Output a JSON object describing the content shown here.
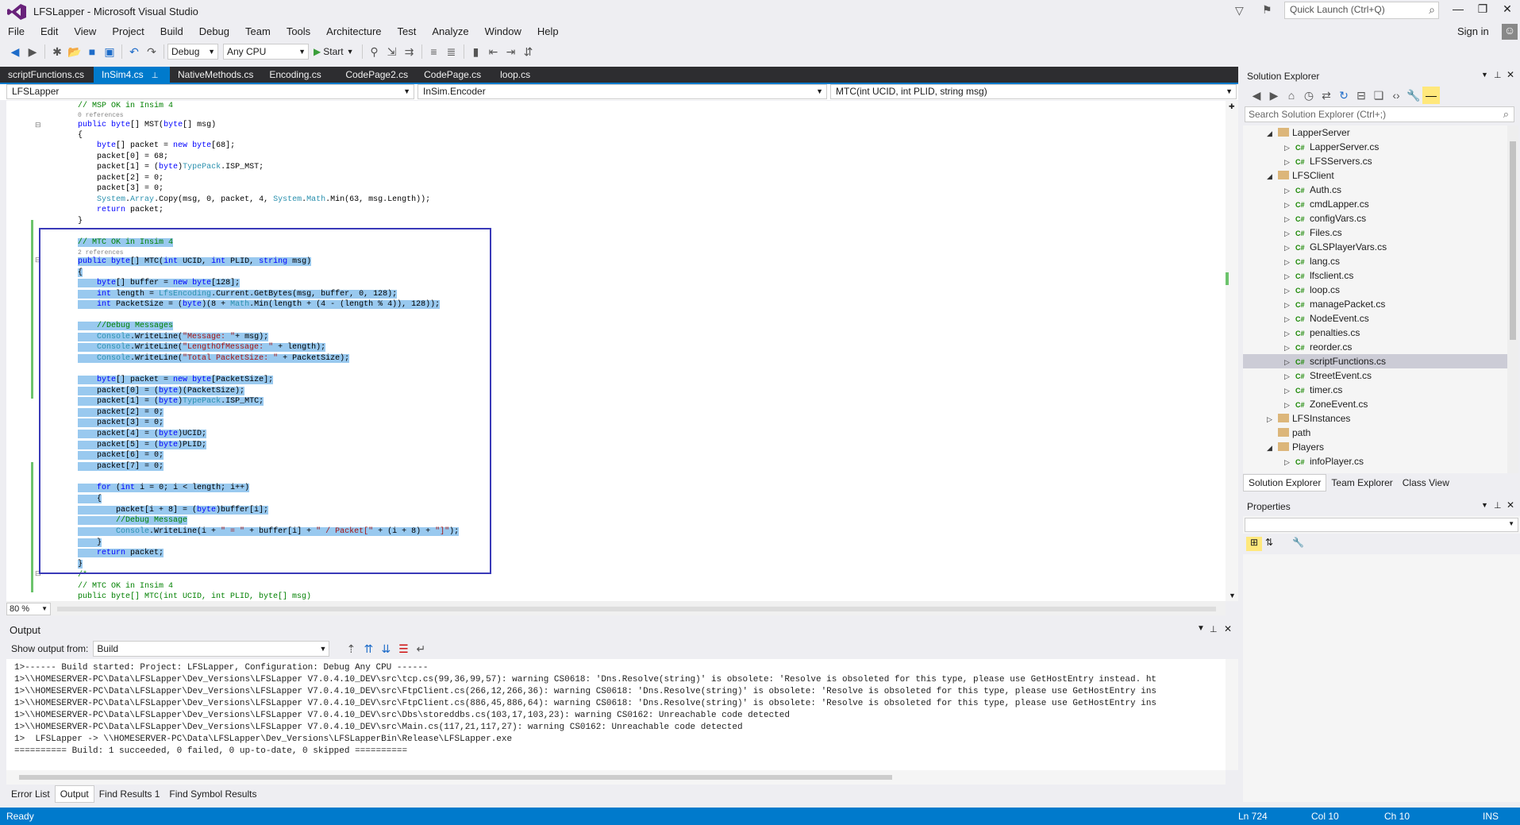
{
  "window": {
    "title": "LFSLapper - Microsoft Visual Studio",
    "quick_launch_placeholder": "Quick Launch (Ctrl+Q)",
    "sign_in": "Sign in"
  },
  "menu": [
    "File",
    "Edit",
    "View",
    "Project",
    "Build",
    "Debug",
    "Team",
    "Tools",
    "Architecture",
    "Test",
    "Analyze",
    "Window",
    "Help"
  ],
  "toolbar": {
    "config": "Debug",
    "platform": "Any CPU",
    "start_label": "Start"
  },
  "tabs": [
    {
      "label": "scriptFunctions.cs",
      "active": false
    },
    {
      "label": "InSim4.cs",
      "active": true
    },
    {
      "label": "NativeMethods.cs",
      "active": false
    },
    {
      "label": "Encoding.cs",
      "active": false
    },
    {
      "label": "CodePage2.cs",
      "active": false
    },
    {
      "label": "CodePage.cs",
      "active": false
    },
    {
      "label": "loop.cs",
      "active": false
    }
  ],
  "navbar": {
    "project": "LFSLapper",
    "type": "InSim.Encoder",
    "member": "MTC(int UCID, int PLID, string msg)"
  },
  "editor": {
    "zoom": "80 %"
  },
  "output": {
    "title": "Output",
    "show_from_label": "Show output from:",
    "source": "Build",
    "lines": [
      "1>------ Build started: Project: LFSLapper, Configuration: Debug Any CPU ------",
      "1>\\\\HOMESERVER-PC\\Data\\LFSLapper\\Dev_Versions\\LFSLapper V7.0.4.10_DEV\\src\\tcp.cs(99,36,99,57): warning CS0618: 'Dns.Resolve(string)' is obsolete: 'Resolve is obsoleted for this type, please use GetHostEntry instead. ht",
      "1>\\\\HOMESERVER-PC\\Data\\LFSLapper\\Dev_Versions\\LFSLapper V7.0.4.10_DEV\\src\\FtpClient.cs(266,12,266,36): warning CS0618: 'Dns.Resolve(string)' is obsolete: 'Resolve is obsoleted for this type, please use GetHostEntry ins",
      "1>\\\\HOMESERVER-PC\\Data\\LFSLapper\\Dev_Versions\\LFSLapper V7.0.4.10_DEV\\src\\FtpClient.cs(886,45,886,64): warning CS0618: 'Dns.Resolve(string)' is obsolete: 'Resolve is obsoleted for this type, please use GetHostEntry ins",
      "1>\\\\HOMESERVER-PC\\Data\\LFSLapper\\Dev_Versions\\LFSLapper V7.0.4.10_DEV\\src\\Dbs\\storeddbs.cs(103,17,103,23): warning CS0162: Unreachable code detected",
      "1>\\\\HOMESERVER-PC\\Data\\LFSLapper\\Dev_Versions\\LFSLapper V7.0.4.10_DEV\\src\\Main.cs(117,21,117,27): warning CS0162: Unreachable code detected",
      "1>  LFSLapper -> \\\\HOMESERVER-PC\\Data\\LFSLapper\\Dev_Versions\\LFSLapperBin\\Release\\LFSLapper.exe",
      "========== Build: 1 succeeded, 0 failed, 0 up-to-date, 0 skipped =========="
    ]
  },
  "bottom_tabs": [
    "Error List",
    "Output",
    "Find Results 1",
    "Find Symbol Results"
  ],
  "solution_explorer": {
    "title": "Solution Explorer",
    "search_placeholder": "Search Solution Explorer (Ctrl+;)",
    "items": [
      {
        "label": "LapperServer",
        "kind": "folder",
        "expanded": true
      },
      {
        "label": "LapperServer.cs",
        "kind": "cs"
      },
      {
        "label": "LFSServers.cs",
        "kind": "cs"
      },
      {
        "label": "LFSClient",
        "kind": "folder",
        "expanded": true
      },
      {
        "label": "Auth.cs",
        "kind": "cs"
      },
      {
        "label": "cmdLapper.cs",
        "kind": "cs"
      },
      {
        "label": "configVars.cs",
        "kind": "cs"
      },
      {
        "label": "Files.cs",
        "kind": "cs"
      },
      {
        "label": "GLSPlayerVars.cs",
        "kind": "cs"
      },
      {
        "label": "lang.cs",
        "kind": "cs"
      },
      {
        "label": "lfsclient.cs",
        "kind": "cs"
      },
      {
        "label": "loop.cs",
        "kind": "cs"
      },
      {
        "label": "managePacket.cs",
        "kind": "cs"
      },
      {
        "label": "NodeEvent.cs",
        "kind": "cs"
      },
      {
        "label": "penalties.cs",
        "kind": "cs"
      },
      {
        "label": "reorder.cs",
        "kind": "cs"
      },
      {
        "label": "scriptFunctions.cs",
        "kind": "cs",
        "selected": true
      },
      {
        "label": "StreetEvent.cs",
        "kind": "cs"
      },
      {
        "label": "timer.cs",
        "kind": "cs"
      },
      {
        "label": "ZoneEvent.cs",
        "kind": "cs"
      },
      {
        "label": "LFSInstances",
        "kind": "folder",
        "expanded": false
      },
      {
        "label": "path",
        "kind": "folder",
        "expanded": null
      },
      {
        "label": "Players",
        "kind": "folder",
        "expanded": true
      },
      {
        "label": "infoPlayer.cs",
        "kind": "cs"
      }
    ],
    "tabs": [
      "Solution Explorer",
      "Team Explorer",
      "Class View"
    ]
  },
  "properties": {
    "title": "Properties"
  },
  "status": {
    "ready": "Ready",
    "ln": "Ln 724",
    "col": "Col 10",
    "ch": "Ch 10",
    "ins": "INS"
  }
}
